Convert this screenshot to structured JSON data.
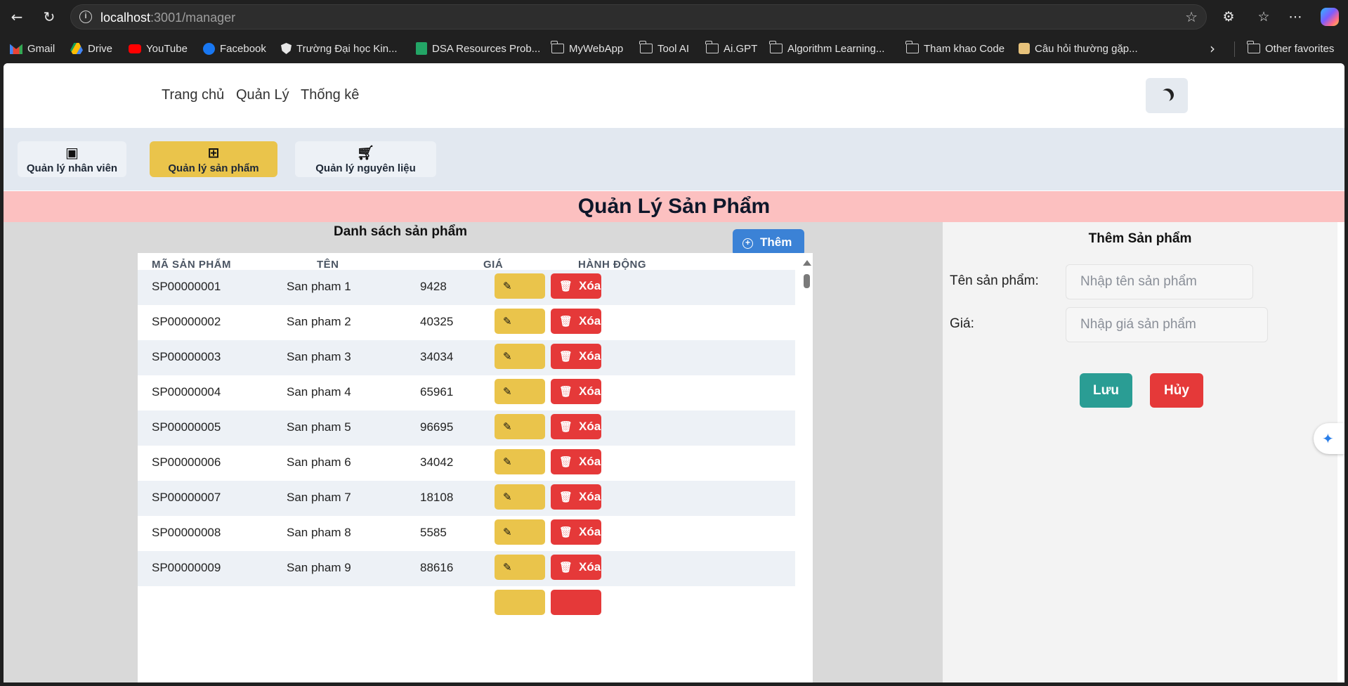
{
  "browser": {
    "url_host": "localhost",
    "url_rest": ":3001/manager",
    "bookmarks": [
      {
        "label": "Gmail",
        "icon": "gmail-icon"
      },
      {
        "label": "Drive",
        "icon": "drive-icon"
      },
      {
        "label": "YouTube",
        "icon": "youtube-icon"
      },
      {
        "label": "Facebook",
        "icon": "facebook-icon"
      },
      {
        "label": "Trường Đại học Kin...",
        "icon": "shield-icon"
      },
      {
        "label": "DSA Resources Prob...",
        "icon": "sheets-icon"
      },
      {
        "label": "MyWebApp",
        "icon": "folder-icon"
      },
      {
        "label": "Tool AI",
        "icon": "folder-icon"
      },
      {
        "label": "Ai.GPT",
        "icon": "folder-icon"
      },
      {
        "label": "Algorithm Learning...",
        "icon": "folder-icon"
      },
      {
        "label": "Tham khao Code",
        "icon": "folder-icon"
      },
      {
        "label": "Câu hỏi thường gặp...",
        "icon": "page-icon"
      }
    ],
    "other_favorites": "Other favorites"
  },
  "nav": {
    "home": "Trang chủ",
    "manage": "Quản Lý",
    "stats": "Thống kê"
  },
  "tabs": [
    {
      "label": "Quản lý nhân viên",
      "icon": "person-folder-icon"
    },
    {
      "label": "Quản lý sản phẩm",
      "icon": "grid-plus-icon"
    },
    {
      "label": "Quản lý nguyên liệu",
      "icon": "cart-icon"
    }
  ],
  "page_title": "Quản Lý Sản Phẩm",
  "list": {
    "title": "Danh sách sản phẩm",
    "add_label": "Thêm",
    "headers": [
      "MÃ SẢN PHẨM",
      "TÊN",
      "GIÁ",
      "HÀNH ĐỘNG"
    ],
    "edit_label": "Sửa",
    "delete_label": "Xóa",
    "rows": [
      {
        "code": "SP00000001",
        "name": "San pham 1",
        "price": "9428"
      },
      {
        "code": "SP00000002",
        "name": "San pham 2",
        "price": "40325"
      },
      {
        "code": "SP00000003",
        "name": "San pham 3",
        "price": "34034"
      },
      {
        "code": "SP00000004",
        "name": "San pham 4",
        "price": "65961"
      },
      {
        "code": "SP00000005",
        "name": "San pham 5",
        "price": "96695"
      },
      {
        "code": "SP00000006",
        "name": "San pham 6",
        "price": "34042"
      },
      {
        "code": "SP00000007",
        "name": "San pham 7",
        "price": "18108"
      },
      {
        "code": "SP00000008",
        "name": "San pham 8",
        "price": "5585"
      },
      {
        "code": "SP00000009",
        "name": "San pham 9",
        "price": "88616"
      }
    ]
  },
  "form": {
    "title": "Thêm Sản phẩm",
    "name_label": "Tên sản phẩm:",
    "name_placeholder": "Nhập tên sản phẩm",
    "price_label": "Giá:",
    "price_placeholder": "Nhập giá sản phẩm",
    "save_label": "Lưu",
    "cancel_label": "Hủy"
  },
  "colors": {
    "accent_yellow": "#eac44b",
    "danger_red": "#e53939",
    "primary_blue": "#3b82d6",
    "teal": "#2a9d94",
    "title_pink": "#fcc0c0"
  }
}
